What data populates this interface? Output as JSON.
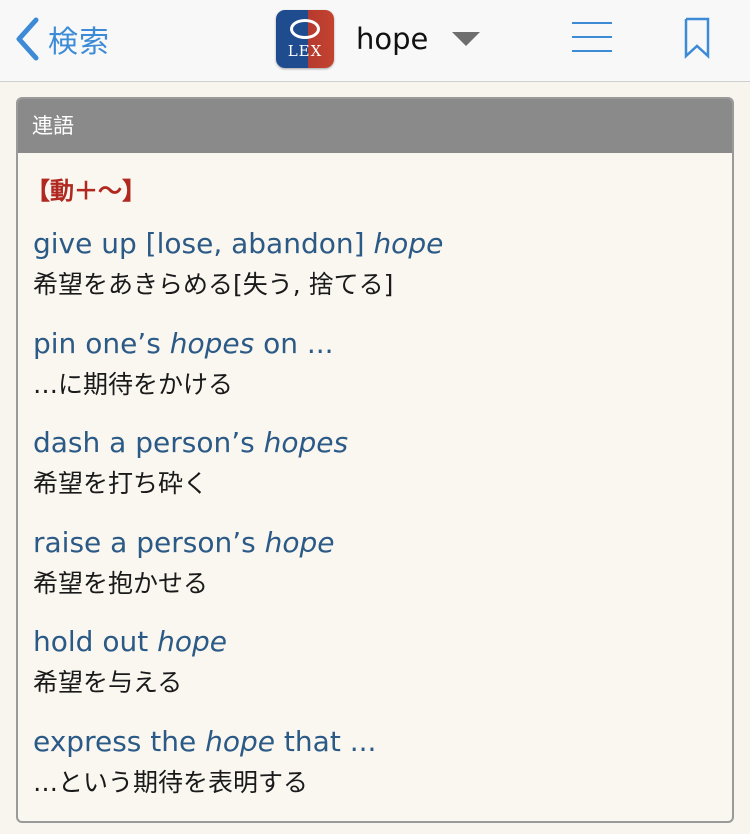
{
  "nav": {
    "back_label": "検索",
    "logo_text": "LEX",
    "title": "hope"
  },
  "panel": {
    "header": "連語",
    "category": "【動＋〜】",
    "entries": [
      {
        "en_pre": "give up [lose, abandon] ",
        "en_em": "hope",
        "en_post": "",
        "ja": "希望をあきらめる[失う, 捨てる]"
      },
      {
        "en_pre": "pin one’s ",
        "en_em": "hopes",
        "en_post": " on ...",
        "ja": "…に期待をかける"
      },
      {
        "en_pre": "dash a person’s ",
        "en_em": "hopes",
        "en_post": "",
        "ja": "希望を打ち砕く"
      },
      {
        "en_pre": "raise a person’s ",
        "en_em": "hope",
        "en_post": "",
        "ja": "希望を抱かせる"
      },
      {
        "en_pre": "hold out ",
        "en_em": "hope",
        "en_post": "",
        "ja": "希望を与える"
      },
      {
        "en_pre": "express the ",
        "en_em": "hope",
        "en_post": " that ...",
        "ja": "…という期待を表明する"
      }
    ]
  },
  "colors": {
    "accent": "#3d8bd6",
    "link_text": "#2b5a86",
    "category_red": "#b0281f",
    "panel_header_bg": "#8a8a8a",
    "background": "#f8f5ef"
  },
  "icons": {
    "back": "chevron-left-icon",
    "dropdown": "triangle-down-icon",
    "menu": "hamburger-menu-icon",
    "bookmark": "bookmark-icon"
  }
}
